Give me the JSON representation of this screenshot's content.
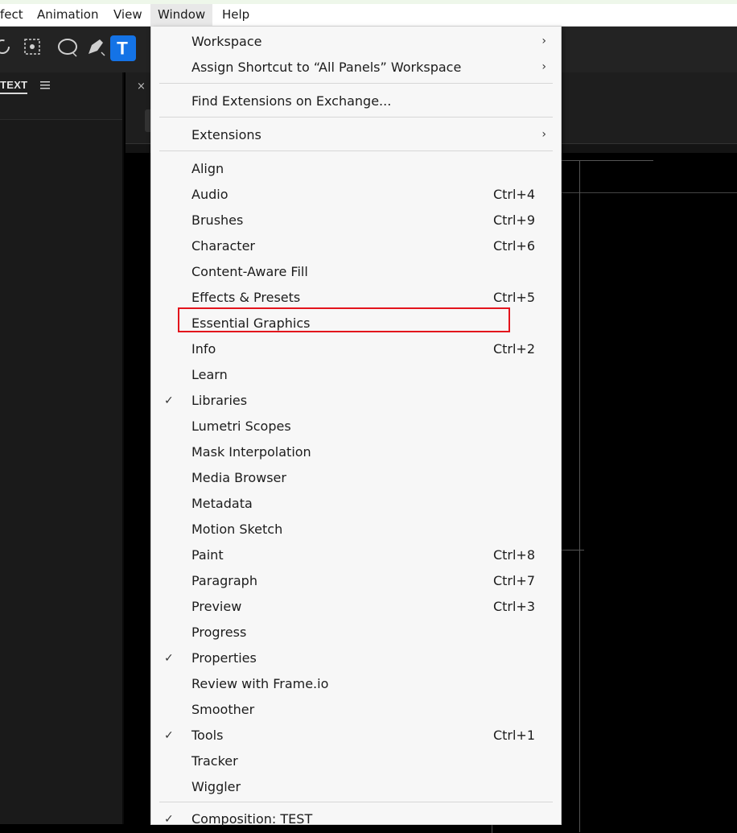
{
  "menubar": {
    "items": [
      {
        "label": "fect"
      },
      {
        "label": "Animation"
      },
      {
        "label": "View"
      },
      {
        "label": "Window"
      },
      {
        "label": "Help"
      }
    ]
  },
  "toolbar": {
    "tools": [
      "rotation-tool-icon",
      "pan-behind-tool-icon",
      "ellipse-tool-icon",
      "pen-tool-icon",
      "type-tool-icon"
    ],
    "type_tool_glyph": "T",
    "active_color": "#1473e6"
  },
  "left_panel": {
    "tab_label": "TEXT"
  },
  "mid_panel": {
    "close_glyph": "×"
  },
  "window_menu": {
    "items": [
      {
        "label": "Workspace",
        "submenu": true
      },
      {
        "label": "Assign Shortcut to “All Panels” Workspace",
        "submenu": true
      },
      {
        "label": "Find Extensions on Exchange..."
      },
      {
        "label": "Extensions",
        "submenu": true
      },
      {
        "label": "Align"
      },
      {
        "label": "Audio",
        "shortcut": "Ctrl+4"
      },
      {
        "label": "Brushes",
        "shortcut": "Ctrl+9"
      },
      {
        "label": "Character",
        "shortcut": "Ctrl+6"
      },
      {
        "label": "Content-Aware Fill"
      },
      {
        "label": "Effects & Presets",
        "shortcut": "Ctrl+5"
      },
      {
        "label": "Essential Graphics",
        "highlighted": true
      },
      {
        "label": "Info",
        "shortcut": "Ctrl+2"
      },
      {
        "label": "Learn"
      },
      {
        "label": "Libraries",
        "checked": true
      },
      {
        "label": "Lumetri Scopes"
      },
      {
        "label": "Mask Interpolation"
      },
      {
        "label": "Media Browser"
      },
      {
        "label": "Metadata"
      },
      {
        "label": "Motion Sketch"
      },
      {
        "label": "Paint",
        "shortcut": "Ctrl+8"
      },
      {
        "label": "Paragraph",
        "shortcut": "Ctrl+7"
      },
      {
        "label": "Preview",
        "shortcut": "Ctrl+3"
      },
      {
        "label": "Progress"
      },
      {
        "label": "Properties",
        "checked": true
      },
      {
        "label": "Review with Frame.io"
      },
      {
        "label": "Smoother"
      },
      {
        "label": "Tools",
        "checked": true,
        "shortcut": "Ctrl+1"
      },
      {
        "label": "Tracker"
      },
      {
        "label": "Wiggler"
      },
      {
        "label": "Composition: TEST",
        "checked": true
      }
    ],
    "check_glyph": "✓",
    "arrow_glyph": "›",
    "highlight_color": "#e3141c"
  }
}
